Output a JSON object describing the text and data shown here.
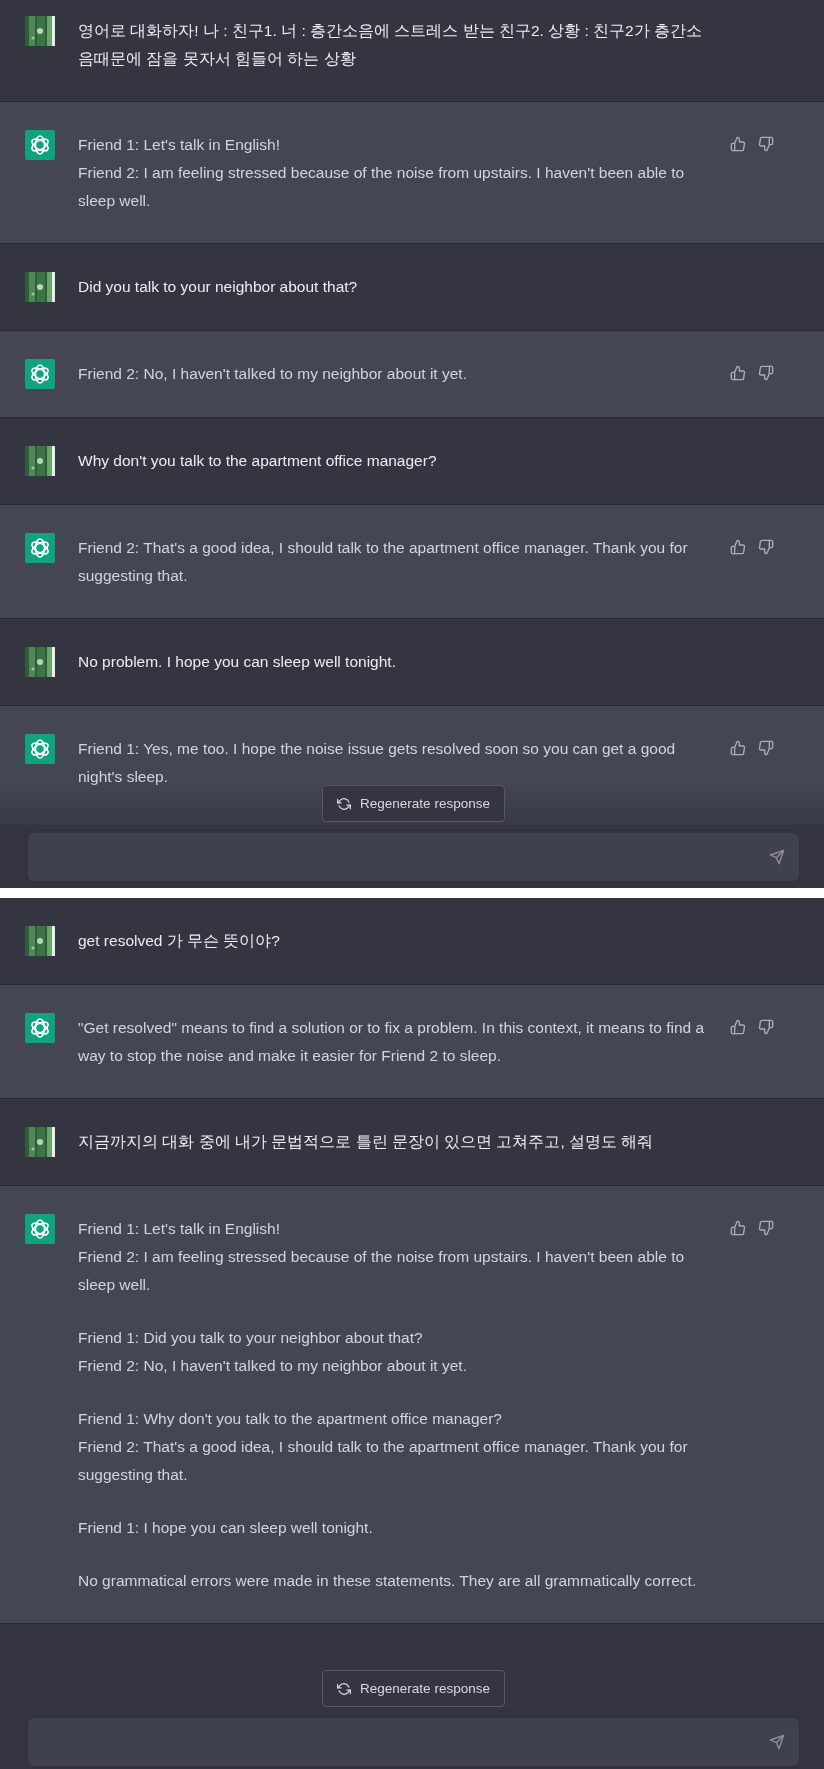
{
  "segments": [
    {
      "messages": [
        {
          "kind": "user",
          "text": "영어로 대화하자! 나 : 친구1. 너 : 층간소음에 스트레스 받는 친구2. 상황 : 친구2가 층간소음때문에 잠을 못자서 힘들어 하는 상황"
        },
        {
          "kind": "assistant",
          "paragraphs": [
            [
              "Friend 1: Let's talk in English!",
              "Friend 2: I am feeling stressed because of the noise from upstairs. I haven't been able to sleep well."
            ]
          ]
        },
        {
          "kind": "user",
          "text": "Did you talk to your neighbor about that?"
        },
        {
          "kind": "assistant",
          "paragraphs": [
            [
              "Friend 2: No, I haven't talked to my neighbor about it yet."
            ]
          ]
        },
        {
          "kind": "user",
          "text": "Why don't you talk to the apartment office manager?"
        },
        {
          "kind": "assistant",
          "paragraphs": [
            [
              "Friend 2: That's a good idea, I should talk to the apartment office manager. Thank you for suggesting that."
            ]
          ]
        },
        {
          "kind": "user",
          "text": "No problem. I hope you can sleep well tonight."
        },
        {
          "kind": "assistant",
          "paragraphs": [
            [
              "Friend 1: Yes, me too. I hope the noise issue gets resolved soon so you can get a good night's sleep."
            ]
          ]
        }
      ],
      "regenerate_button": "Regenerate response"
    },
    {
      "messages": [
        {
          "kind": "user",
          "text": "get resolved 가 무슨 뜻이야?"
        },
        {
          "kind": "assistant",
          "paragraphs": [
            [
              "\"Get resolved\" means to find a solution or to fix a problem. In this context, it means to find a way to stop the noise and make it easier for Friend 2 to sleep."
            ]
          ]
        },
        {
          "kind": "user",
          "text": "지금까지의 대화 중에 내가 문법적으로 틀린 문장이 있으면 고쳐주고, 설명도 해줘"
        },
        {
          "kind": "assistant",
          "paragraphs": [
            [
              "Friend 1: Let's talk in English!",
              "Friend 2: I am feeling stressed because of the noise from upstairs. I haven't been able to sleep well."
            ],
            [
              "Friend 1: Did you talk to your neighbor about that?",
              "Friend 2: No, I haven't talked to my neighbor about it yet."
            ],
            [
              "Friend 1: Why don't you talk to the apartment office manager?",
              "Friend 2: That's a good idea, I should talk to the apartment office manager. Thank you for suggesting that."
            ],
            [
              "Friend 1: I hope you can sleep well tonight."
            ],
            [
              "No grammatical errors were made in these statements. They are all grammatically correct."
            ]
          ]
        }
      ],
      "regenerate_button": "Regenerate response"
    }
  ]
}
